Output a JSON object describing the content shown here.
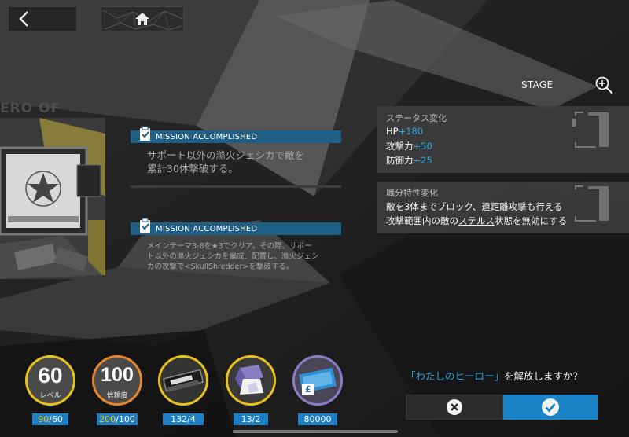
{
  "stage": {
    "label": "STAGE"
  },
  "art": {
    "title_fragment": "ERO OF"
  },
  "missions": [
    {
      "status": "MISSION ACCOMPLISHED",
      "line1": "サポート以外の滌火ジェシカで敵を",
      "line2": "累計30体撃破する。"
    },
    {
      "status": "MISSION ACCOMPLISHED",
      "line1": "メインテーマ3-8を★3でクリア。その際、サポー",
      "line2": "ト以外の滌火ジェシカを編成、配置し、滌火ジェシ",
      "line3": "カの攻撃で<SkullShredder>を撃破する。"
    }
  ],
  "status_change": {
    "title": "ステータス変化",
    "stats": [
      {
        "name": "HP",
        "value": "+180"
      },
      {
        "name": "攻撃力",
        "value": "+50"
      },
      {
        "name": "防御力",
        "value": "+25"
      }
    ]
  },
  "trait_change": {
    "title": "職分特性変化",
    "line1": "敵を3体までブロック、遠距離攻撃も行える",
    "line2_pre": "攻撃範囲内の敵の",
    "line2_ul": "ステルス",
    "line2_post": "状態を無効にする"
  },
  "resources": {
    "level": {
      "value": "60",
      "label": "レベル",
      "current": "90",
      "required": "60"
    },
    "trust": {
      "value": "100",
      "label": "信頼度",
      "current": "200",
      "required": "100"
    },
    "item1": {
      "current": "132",
      "required": "4"
    },
    "item2": {
      "current": "13",
      "required": "2"
    },
    "lmd": {
      "amount": "80000"
    }
  },
  "confirm": {
    "quote_open": "「わたしのヒーロー」",
    "question_rest": "を解放しますか？"
  },
  "colors": {
    "accent": "#1f7fc4",
    "value_blue": "#2ea6e0",
    "level_ring": "#e8c21a",
    "trust_ring": "#e8862e",
    "counter_yellow": "#f3c318"
  },
  "icons": [
    "back-arrow-icon",
    "home-icon",
    "zoom-in-icon",
    "clipboard-check-icon",
    "close-icon",
    "check-icon"
  ]
}
